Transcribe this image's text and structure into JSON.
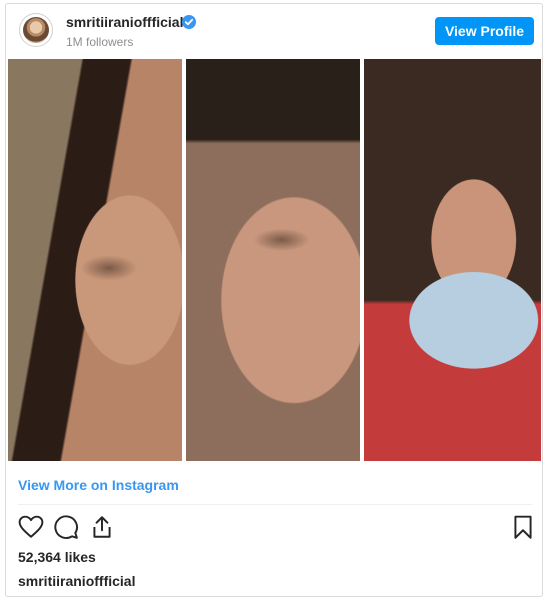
{
  "header": {
    "username": "smritiiranioffficial",
    "followers": "1M followers",
    "view_profile_label": "View Profile"
  },
  "media": {
    "panels": [
      "face-left",
      "face-center",
      "face-masked"
    ]
  },
  "links": {
    "view_more": "View More on Instagram"
  },
  "engagement": {
    "likes": "52,364 likes",
    "caption_username": "smritiiranioffficial"
  },
  "icons": [
    "verified-badge-icon",
    "heart-icon",
    "comment-icon",
    "share-icon",
    "bookmark-icon"
  ],
  "colors": {
    "accent": "#0095f6",
    "link": "#3897f0",
    "text": "#262626",
    "muted": "#8e8e8e"
  }
}
